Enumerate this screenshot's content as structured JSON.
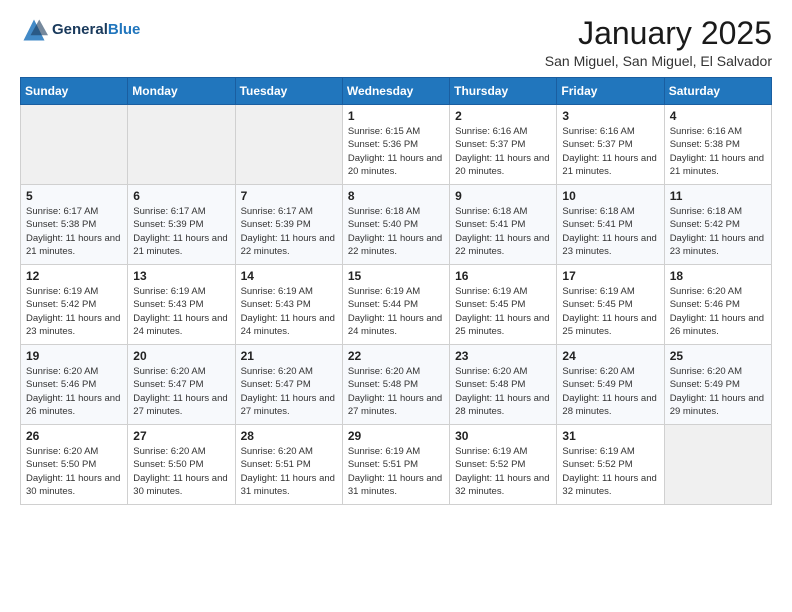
{
  "header": {
    "logo_line1": "General",
    "logo_line2": "Blue",
    "title": "January 2025",
    "subtitle": "San Miguel, San Miguel, El Salvador"
  },
  "weekdays": [
    "Sunday",
    "Monday",
    "Tuesday",
    "Wednesday",
    "Thursday",
    "Friday",
    "Saturday"
  ],
  "weeks": [
    [
      {
        "day": "",
        "sunrise": "",
        "sunset": "",
        "daylight": ""
      },
      {
        "day": "",
        "sunrise": "",
        "sunset": "",
        "daylight": ""
      },
      {
        "day": "",
        "sunrise": "",
        "sunset": "",
        "daylight": ""
      },
      {
        "day": "1",
        "sunrise": "Sunrise: 6:15 AM",
        "sunset": "Sunset: 5:36 PM",
        "daylight": "Daylight: 11 hours and 20 minutes."
      },
      {
        "day": "2",
        "sunrise": "Sunrise: 6:16 AM",
        "sunset": "Sunset: 5:37 PM",
        "daylight": "Daylight: 11 hours and 20 minutes."
      },
      {
        "day": "3",
        "sunrise": "Sunrise: 6:16 AM",
        "sunset": "Sunset: 5:37 PM",
        "daylight": "Daylight: 11 hours and 21 minutes."
      },
      {
        "day": "4",
        "sunrise": "Sunrise: 6:16 AM",
        "sunset": "Sunset: 5:38 PM",
        "daylight": "Daylight: 11 hours and 21 minutes."
      }
    ],
    [
      {
        "day": "5",
        "sunrise": "Sunrise: 6:17 AM",
        "sunset": "Sunset: 5:38 PM",
        "daylight": "Daylight: 11 hours and 21 minutes."
      },
      {
        "day": "6",
        "sunrise": "Sunrise: 6:17 AM",
        "sunset": "Sunset: 5:39 PM",
        "daylight": "Daylight: 11 hours and 21 minutes."
      },
      {
        "day": "7",
        "sunrise": "Sunrise: 6:17 AM",
        "sunset": "Sunset: 5:39 PM",
        "daylight": "Daylight: 11 hours and 22 minutes."
      },
      {
        "day": "8",
        "sunrise": "Sunrise: 6:18 AM",
        "sunset": "Sunset: 5:40 PM",
        "daylight": "Daylight: 11 hours and 22 minutes."
      },
      {
        "day": "9",
        "sunrise": "Sunrise: 6:18 AM",
        "sunset": "Sunset: 5:41 PM",
        "daylight": "Daylight: 11 hours and 22 minutes."
      },
      {
        "day": "10",
        "sunrise": "Sunrise: 6:18 AM",
        "sunset": "Sunset: 5:41 PM",
        "daylight": "Daylight: 11 hours and 23 minutes."
      },
      {
        "day": "11",
        "sunrise": "Sunrise: 6:18 AM",
        "sunset": "Sunset: 5:42 PM",
        "daylight": "Daylight: 11 hours and 23 minutes."
      }
    ],
    [
      {
        "day": "12",
        "sunrise": "Sunrise: 6:19 AM",
        "sunset": "Sunset: 5:42 PM",
        "daylight": "Daylight: 11 hours and 23 minutes."
      },
      {
        "day": "13",
        "sunrise": "Sunrise: 6:19 AM",
        "sunset": "Sunset: 5:43 PM",
        "daylight": "Daylight: 11 hours and 24 minutes."
      },
      {
        "day": "14",
        "sunrise": "Sunrise: 6:19 AM",
        "sunset": "Sunset: 5:43 PM",
        "daylight": "Daylight: 11 hours and 24 minutes."
      },
      {
        "day": "15",
        "sunrise": "Sunrise: 6:19 AM",
        "sunset": "Sunset: 5:44 PM",
        "daylight": "Daylight: 11 hours and 24 minutes."
      },
      {
        "day": "16",
        "sunrise": "Sunrise: 6:19 AM",
        "sunset": "Sunset: 5:45 PM",
        "daylight": "Daylight: 11 hours and 25 minutes."
      },
      {
        "day": "17",
        "sunrise": "Sunrise: 6:19 AM",
        "sunset": "Sunset: 5:45 PM",
        "daylight": "Daylight: 11 hours and 25 minutes."
      },
      {
        "day": "18",
        "sunrise": "Sunrise: 6:20 AM",
        "sunset": "Sunset: 5:46 PM",
        "daylight": "Daylight: 11 hours and 26 minutes."
      }
    ],
    [
      {
        "day": "19",
        "sunrise": "Sunrise: 6:20 AM",
        "sunset": "Sunset: 5:46 PM",
        "daylight": "Daylight: 11 hours and 26 minutes."
      },
      {
        "day": "20",
        "sunrise": "Sunrise: 6:20 AM",
        "sunset": "Sunset: 5:47 PM",
        "daylight": "Daylight: 11 hours and 27 minutes."
      },
      {
        "day": "21",
        "sunrise": "Sunrise: 6:20 AM",
        "sunset": "Sunset: 5:47 PM",
        "daylight": "Daylight: 11 hours and 27 minutes."
      },
      {
        "day": "22",
        "sunrise": "Sunrise: 6:20 AM",
        "sunset": "Sunset: 5:48 PM",
        "daylight": "Daylight: 11 hours and 27 minutes."
      },
      {
        "day": "23",
        "sunrise": "Sunrise: 6:20 AM",
        "sunset": "Sunset: 5:48 PM",
        "daylight": "Daylight: 11 hours and 28 minutes."
      },
      {
        "day": "24",
        "sunrise": "Sunrise: 6:20 AM",
        "sunset": "Sunset: 5:49 PM",
        "daylight": "Daylight: 11 hours and 28 minutes."
      },
      {
        "day": "25",
        "sunrise": "Sunrise: 6:20 AM",
        "sunset": "Sunset: 5:49 PM",
        "daylight": "Daylight: 11 hours and 29 minutes."
      }
    ],
    [
      {
        "day": "26",
        "sunrise": "Sunrise: 6:20 AM",
        "sunset": "Sunset: 5:50 PM",
        "daylight": "Daylight: 11 hours and 30 minutes."
      },
      {
        "day": "27",
        "sunrise": "Sunrise: 6:20 AM",
        "sunset": "Sunset: 5:50 PM",
        "daylight": "Daylight: 11 hours and 30 minutes."
      },
      {
        "day": "28",
        "sunrise": "Sunrise: 6:20 AM",
        "sunset": "Sunset: 5:51 PM",
        "daylight": "Daylight: 11 hours and 31 minutes."
      },
      {
        "day": "29",
        "sunrise": "Sunrise: 6:19 AM",
        "sunset": "Sunset: 5:51 PM",
        "daylight": "Daylight: 11 hours and 31 minutes."
      },
      {
        "day": "30",
        "sunrise": "Sunrise: 6:19 AM",
        "sunset": "Sunset: 5:52 PM",
        "daylight": "Daylight: 11 hours and 32 minutes."
      },
      {
        "day": "31",
        "sunrise": "Sunrise: 6:19 AM",
        "sunset": "Sunset: 5:52 PM",
        "daylight": "Daylight: 11 hours and 32 minutes."
      },
      {
        "day": "",
        "sunrise": "",
        "sunset": "",
        "daylight": ""
      }
    ]
  ]
}
